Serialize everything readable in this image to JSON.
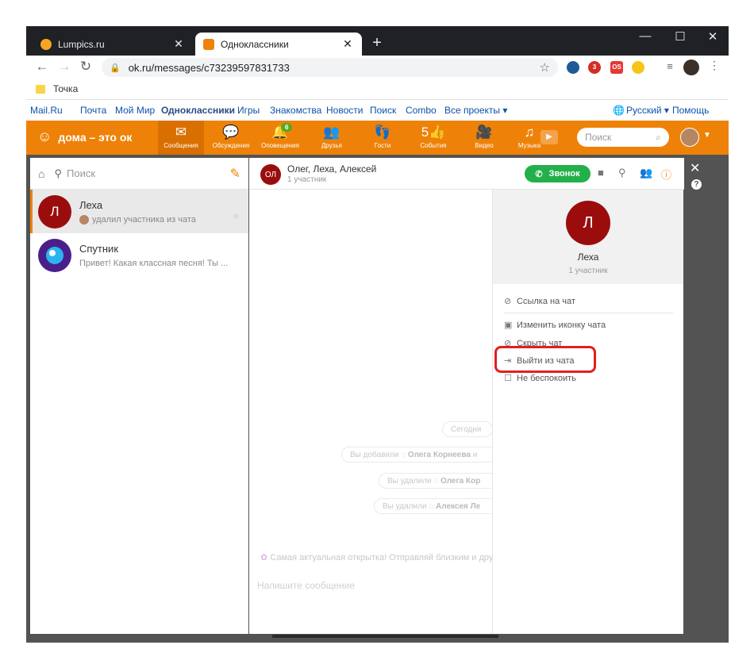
{
  "browser": {
    "tabs": [
      {
        "title": "Lumpics.ru",
        "favicon_color": "#f5a623"
      },
      {
        "title": "Одноклассники",
        "favicon_color": "#ee8208"
      }
    ],
    "new_tab_symbol": "+",
    "url": "ok.ru/messages/c73239597831733",
    "bookmark": "Точка",
    "extensions": [
      {
        "name": "gear-extension-icon",
        "label": "",
        "color": "#1f5a96"
      },
      {
        "name": "lastpass-extension-icon",
        "label": "3",
        "color": "#d32d27"
      },
      {
        "name": "ok-extension-icon",
        "label": "OS",
        "color": "#e53935"
      },
      {
        "name": "gold-extension-icon",
        "label": "",
        "color": "#f5c518"
      }
    ]
  },
  "topnav": {
    "links": [
      "Mail.Ru",
      "Почта",
      "Мой Мир",
      "Одноклассники",
      "Игры",
      "Знакомства",
      "Новости",
      "Поиск",
      "Combo",
      "Все проекты ▾"
    ],
    "language": "Русский ▾",
    "help": "Помощь"
  },
  "ok_header": {
    "logo": "дома – это ок",
    "nav": [
      {
        "label": "Сообщения",
        "icon": "✉",
        "badge": "",
        "selected": true
      },
      {
        "label": "Обсуждения",
        "icon": "💬",
        "badge": "",
        "selected": false
      },
      {
        "label": "Оповещения",
        "icon": "🔔",
        "badge": "6",
        "selected": false
      },
      {
        "label": "Друзья",
        "icon": "👥",
        "badge": "",
        "selected": false
      },
      {
        "label": "Гости",
        "icon": "👣",
        "badge": "",
        "selected": false
      },
      {
        "label": "События",
        "icon": "5👍",
        "badge": "",
        "selected": false
      },
      {
        "label": "Видео",
        "icon": "🎥",
        "badge": "",
        "selected": false
      },
      {
        "label": "Музыка",
        "icon": "♫",
        "badge": "",
        "selected": false
      }
    ],
    "search_placeholder": "Поиск"
  },
  "sidebar": {
    "search_placeholder": "Поиск",
    "chats": [
      {
        "name": "Леха",
        "avatar_letter": "Л",
        "avatar_color": "#9b0d0d",
        "preview": "удалил участника из чата",
        "selected": true
      },
      {
        "name": "Спутник",
        "avatar_letter": "",
        "avatar_color": "#4a1f8c",
        "preview": "Привет! Какая классная песня! Ты ...",
        "selected": false
      }
    ]
  },
  "chat": {
    "avatar": "ОЛ",
    "title": "Олег, Леха, Алексей",
    "subtitle": "1 участник",
    "call_button": "Звонок",
    "day_separator": "Сегодня",
    "events": [
      {
        "prefix": "Вы добавили",
        "name": "Олега Корнеева",
        "suffix": "и"
      },
      {
        "prefix": "Вы удалили",
        "name": "Олега Кор",
        "suffix": ""
      },
      {
        "prefix": "Вы удалили",
        "name": "Алексея Ле",
        "suffix": ""
      }
    ],
    "promo": "Самая актуальная открытка! Отправляй близким и друзья",
    "compose_placeholder": "Напишите сообщение"
  },
  "info_panel": {
    "avatar_letter": "Л",
    "name": "Леха",
    "subtitle": "1 участник",
    "menu": [
      {
        "label": "Ссылка на чат",
        "icon": "link-icon"
      },
      {
        "label": "Изменить иконку чата",
        "icon": "image-icon"
      },
      {
        "label": "Скрыть чат",
        "icon": "hide-icon"
      },
      {
        "label": "Выйти из чата",
        "icon": "exit-icon"
      },
      {
        "label": "Не беспокоить",
        "icon": "checkbox-icon"
      }
    ],
    "highlight_color": "#e02020"
  }
}
